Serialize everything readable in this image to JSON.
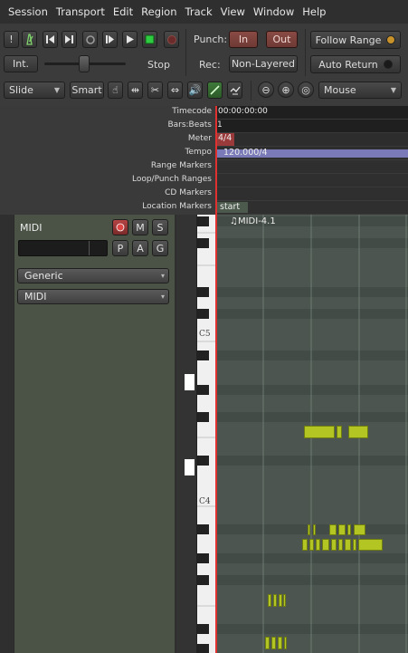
{
  "menubar": [
    "Session",
    "Transport",
    "Edit",
    "Region",
    "Track",
    "View",
    "Window",
    "Help"
  ],
  "toolbar": {
    "transport_icons": [
      "exclamation",
      "metronome",
      "go-to-start",
      "go-to-end",
      "loop",
      "play-range",
      "play",
      "stop",
      "record"
    ],
    "punch_label": "Punch:",
    "punch_in": "In",
    "punch_out": "Out",
    "follow_range": "Follow Range",
    "int_label": "Int.",
    "stop_label": "Stop",
    "rec_label": "Rec:",
    "rec_mode": "Non-Layered",
    "auto_return": "Auto Return",
    "edit_mode": "Slide",
    "smart_label": "Smart",
    "grab_mode": "Mouse",
    "colors": {
      "accent_green": "#2ecc40",
      "record_red": "#c0392b",
      "note": "#b2c523"
    }
  },
  "rulers": {
    "labels": [
      "Timecode",
      "Bars:Beats",
      "Meter",
      "Tempo",
      "Range Markers",
      "Loop/Punch Ranges",
      "CD Markers",
      "Location Markers"
    ],
    "timecode_value": "00:00:00:00",
    "bars_value": "1",
    "meter_value": "4/4",
    "tempo_value": "120.000/4",
    "location_value": "start"
  },
  "track": {
    "name": "MIDI",
    "buttons": [
      "M",
      "S",
      "P",
      "A",
      "G"
    ],
    "instrument": "Generic",
    "channel": "MIDI"
  },
  "keyboard": {
    "octave_labels": [
      "C5",
      "C4"
    ]
  },
  "region": {
    "name": "♫MIDI-4.1"
  }
}
